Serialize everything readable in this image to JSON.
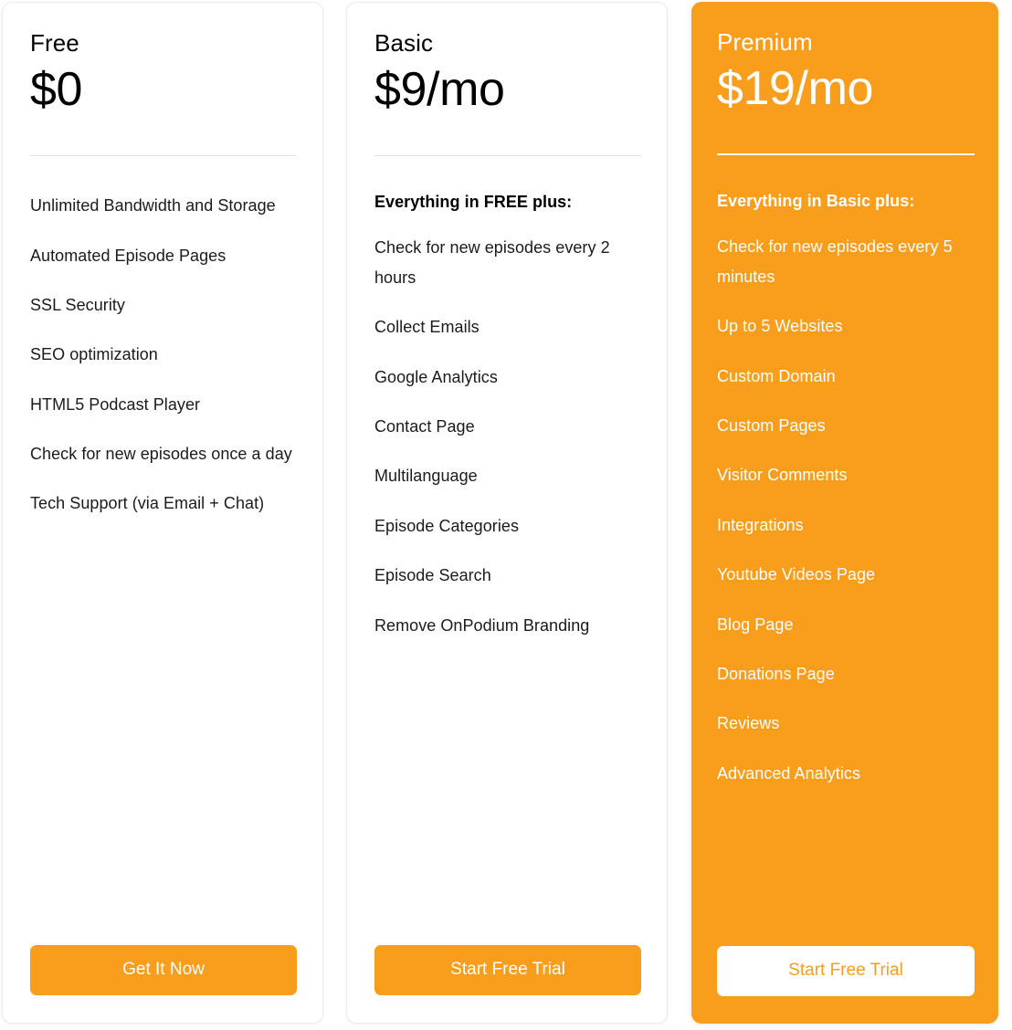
{
  "theme": {
    "accent": "#f99d1c",
    "card_bg": "#ffffff",
    "card_border": "#ececec",
    "text": "#1b1b1b",
    "divider": "#e3e3e3"
  },
  "plans": [
    {
      "id": "free",
      "name": "Free",
      "price": "$0",
      "heading": null,
      "features": [
        "Unlimited Bandwidth and Storage",
        "Automated Episode Pages",
        "SSL Security",
        "SEO optimization",
        "HTML5 Podcast Player",
        "Check for new episodes once a day",
        "Tech Support (via Email + Chat)"
      ],
      "cta_label": "Get It Now"
    },
    {
      "id": "basic",
      "name": "Basic",
      "price": "$9/mo",
      "heading": "Everything in FREE plus:",
      "features": [
        "Check for new episodes every 2 hours",
        "Collect Emails",
        "Google Analytics",
        "Contact Page",
        "Multilanguage",
        "Episode Categories",
        "Episode Search",
        "Remove OnPodium Branding"
      ],
      "cta_label": "Start Free Trial"
    },
    {
      "id": "premium",
      "name": "Premium",
      "price": "$19/mo",
      "heading": "Everything in Basic plus:",
      "features": [
        "Check for new episodes every 5 minutes",
        "Up to 5 Websites",
        "Custom Domain",
        "Custom Pages",
        "Visitor Comments",
        "Integrations",
        "Youtube Videos Page",
        "Blog Page",
        "Donations Page",
        "Reviews",
        "Advanced Analytics"
      ],
      "cta_label": "Start Free Trial"
    }
  ]
}
